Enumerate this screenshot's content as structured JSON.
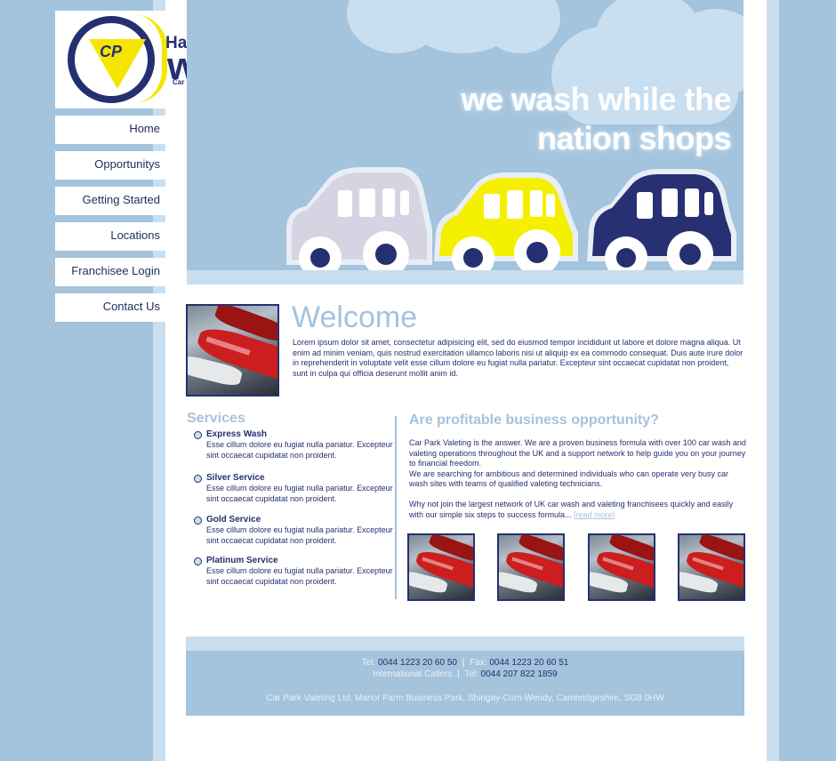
{
  "brand": {
    "logo_initials": "CP",
    "logo_line1": "Hand Car",
    "logo_line2": "wash",
    "logo_sub": "Car Park Valeting Ltd"
  },
  "nav": {
    "items": [
      {
        "label": "Home"
      },
      {
        "label": "Opportunitys"
      },
      {
        "label": "Getting Started"
      },
      {
        "label": "Locations"
      },
      {
        "label": "Franchisee Login"
      },
      {
        "label": "Contact Us"
      }
    ]
  },
  "hero": {
    "tagline_line1": "we wash while the",
    "tagline_line2": "nation shops",
    "car_colors": [
      "#d6d4e2",
      "#f5f000",
      "#263072"
    ]
  },
  "welcome": {
    "title": "Welcome",
    "text": "Lorem ipsum dolor sit amet, consectetur adipisicing elit, sed do eiusmod tempor incididunt ut labore et dolore magna aliqua. Ut enim ad minim veniam, quis nostrud exercitation ullamco laboris nisi ut aliquip ex ea commodo consequat. Duis aute irure dolor in reprehenderit in voluptate velit esse cillum dolore eu fugiat nulla pariatur. Excepteur sint occaecat cupidatat non proident, sunt in culpa qui officia deserunt mollit anim id."
  },
  "services": {
    "title": "Services",
    "items": [
      {
        "name": "Express Wash",
        "desc": "Esse cillum dolore eu fugiat nulla pariatur. Excepteur sint occaecat cupidatat non proident."
      },
      {
        "name": "Silver Service",
        "desc": "Esse cillum dolore eu fugiat nulla pariatur. Excepteur sint occaecat cupidatat non proident."
      },
      {
        "name": "Gold Service",
        "desc": "Esse cillum dolore eu fugiat nulla pariatur. Excepteur sint occaecat cupidatat non proident."
      },
      {
        "name": "Platinum Service",
        "desc": "Esse cillum dolore eu fugiat nulla pariatur. Excepteur sint occaecat cupidatat non proident."
      }
    ]
  },
  "opportunity": {
    "title": "Are profitable business opportunity?",
    "p1": "Car Park Valeting is the answer. We are a proven business formula with over 100 car wash and valeting operations throughout the UK and a support network to help guide you on your journey to financial freedom.",
    "p2": "We are searching for ambitious and determined individuals who can operate very busy car wash sites with teams of qualified valeting technicians.",
    "p3": "Why not join the largest network of UK car wash and valeting franchisees quickly and easily with our simple six steps to success formula...",
    "read_more": "[read more]"
  },
  "footer": {
    "tel_label": "Tel:",
    "tel": "0044 1223 20 60 50",
    "fax_label": "Fax:",
    "fax": "0044 1223 20 60 51",
    "intl_label": "International Callers",
    "intl_tel_label": "Tel:",
    "intl_tel": "0044 207 822 1859",
    "separator": "|",
    "address": "Car Park Valeting Ltd, Manor Farm Business Park, Shingay-Cum-Wendy, Cambridgeshire, SG8 0HW"
  },
  "colors": {
    "page_bg": "#a4c3dc",
    "light_blue": "#c9dff0",
    "navy": "#253070",
    "accent_yellow": "#f5e600"
  }
}
